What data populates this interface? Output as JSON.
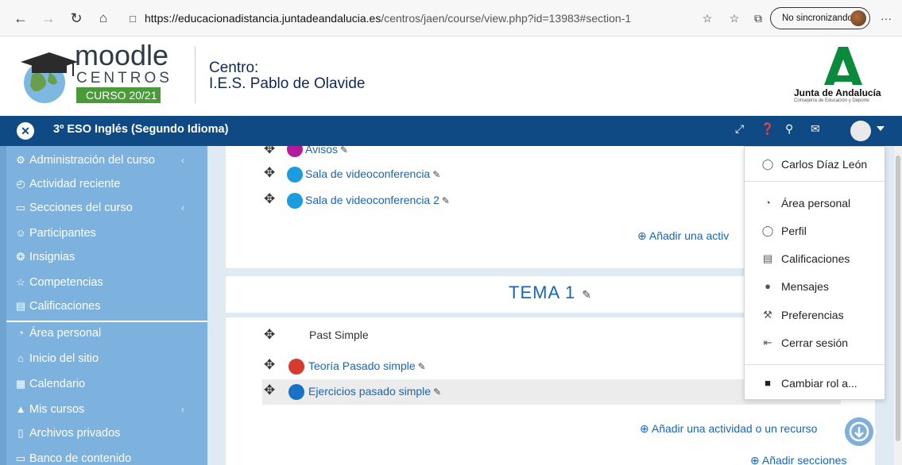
{
  "browser": {
    "url_host": "https://educacionadistancia.juntadeandalucia.es",
    "url_path": "/centros/jaen/course/view.php?id=13983#section-1",
    "sync_label": "No sincronizando",
    "more_label": "···"
  },
  "header": {
    "logo_word": "moodle",
    "logo_sub": "CENTROS",
    "logo_badge": "CURSO 20/21",
    "centro_label": "Centro:",
    "centro_name": "I.E.S. Pablo de Olavide",
    "junta_title": "Junta de Andalucía",
    "junta_sub": "Consejería de Educación y Deporte"
  },
  "navbar": {
    "course_title": "3º ESO Inglés (Segundo Idioma)"
  },
  "sidebar": {
    "items": [
      {
        "label": "Administración del curso",
        "icon": "gears-icon",
        "chevron": true
      },
      {
        "label": "Actividad reciente",
        "icon": "clock-icon",
        "chevron": false
      },
      {
        "label": "Secciones del curso",
        "icon": "folder-icon",
        "chevron": true
      },
      {
        "label": "Participantes",
        "icon": "users-icon",
        "chevron": false
      },
      {
        "label": "Insignias",
        "icon": "badge-icon",
        "chevron": false
      },
      {
        "label": "Competencias",
        "icon": "star-icon",
        "chevron": false
      },
      {
        "label": "Calificaciones",
        "icon": "grades-icon",
        "chevron": false
      },
      {
        "label": "Área personal",
        "icon": "dashboard-icon",
        "chevron": false
      },
      {
        "label": "Inicio del sitio",
        "icon": "home-icon",
        "chevron": false
      },
      {
        "label": "Calendario",
        "icon": "calendar-icon",
        "chevron": false
      },
      {
        "label": "Mis cursos",
        "icon": "graduation-cap-icon",
        "chevron": true
      },
      {
        "label": "Archivos privados",
        "icon": "files-icon",
        "chevron": false
      },
      {
        "label": "Banco de contenido",
        "icon": "folder-icon",
        "chevron": false
      }
    ]
  },
  "main": {
    "section0": {
      "activities": [
        {
          "label": "Avisos",
          "icon": "forum-icon"
        },
        {
          "label": "Sala de videoconferencia",
          "icon": "videoconference-icon"
        },
        {
          "label": "Sala de videoconferencia 2",
          "icon": "videoconference-icon"
        }
      ],
      "add_label": "Añadir una activ"
    },
    "section1": {
      "title": "TEMA 1",
      "label_text": "Past Simple",
      "activities": [
        {
          "label": "Teoría Pasado simple",
          "icon": "pdf-icon"
        },
        {
          "label": "Ejercicios pasado simple",
          "icon": "folder-resource-icon"
        }
      ],
      "add_label": "Añadir una actividad o un recurso",
      "add_sections_label": "Añadir secciones"
    }
  },
  "usermenu": {
    "user_name": "Carlos Díaz León",
    "items": [
      {
        "label": "Área personal",
        "icon": "dashboard-icon"
      },
      {
        "label": "Perfil",
        "icon": "user-icon"
      },
      {
        "label": "Calificaciones",
        "icon": "grades-icon"
      },
      {
        "label": "Mensajes",
        "icon": "speech-bubble-icon"
      },
      {
        "label": "Preferencias",
        "icon": "wrench-icon"
      },
      {
        "label": "Cerrar sesión",
        "icon": "logout-icon"
      }
    ],
    "switch_role_label": "Cambiar rol a..."
  }
}
